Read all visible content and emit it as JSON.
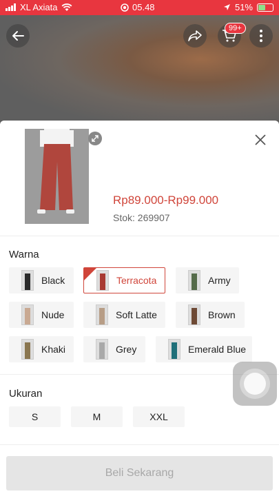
{
  "status_bar": {
    "carrier": "XL Axiata",
    "time": "05.48",
    "battery": "51%",
    "battery_level": 0.51
  },
  "top_actions": {
    "cart_badge": "99+"
  },
  "product": {
    "price": "Rp89.000-Rp99.000",
    "stock": "Stok: 269907"
  },
  "variants": {
    "title": "Warna",
    "selected": "Terracota",
    "options": [
      {
        "label": "Black",
        "color": "#2a2a2a"
      },
      {
        "label": "Terracota",
        "color": "#a83a33"
      },
      {
        "label": "Army",
        "color": "#556b4a"
      },
      {
        "label": "Nude",
        "color": "#c9a992"
      },
      {
        "label": "Soft Latte",
        "color": "#b79d86"
      },
      {
        "label": "Brown",
        "color": "#6e4a35"
      },
      {
        "label": "Khaki",
        "color": "#8a7650"
      },
      {
        "label": "Grey",
        "color": "#a9a9a9"
      },
      {
        "label": "Emerald Blue",
        "color": "#1f6f79"
      }
    ]
  },
  "sizes": {
    "title": "Ukuran",
    "options": [
      "S",
      "M",
      "XXL"
    ]
  },
  "buy_button": "Beli Sekarang",
  "colors": {
    "accent": "#d0453a",
    "status_bar": "#e8363f"
  }
}
